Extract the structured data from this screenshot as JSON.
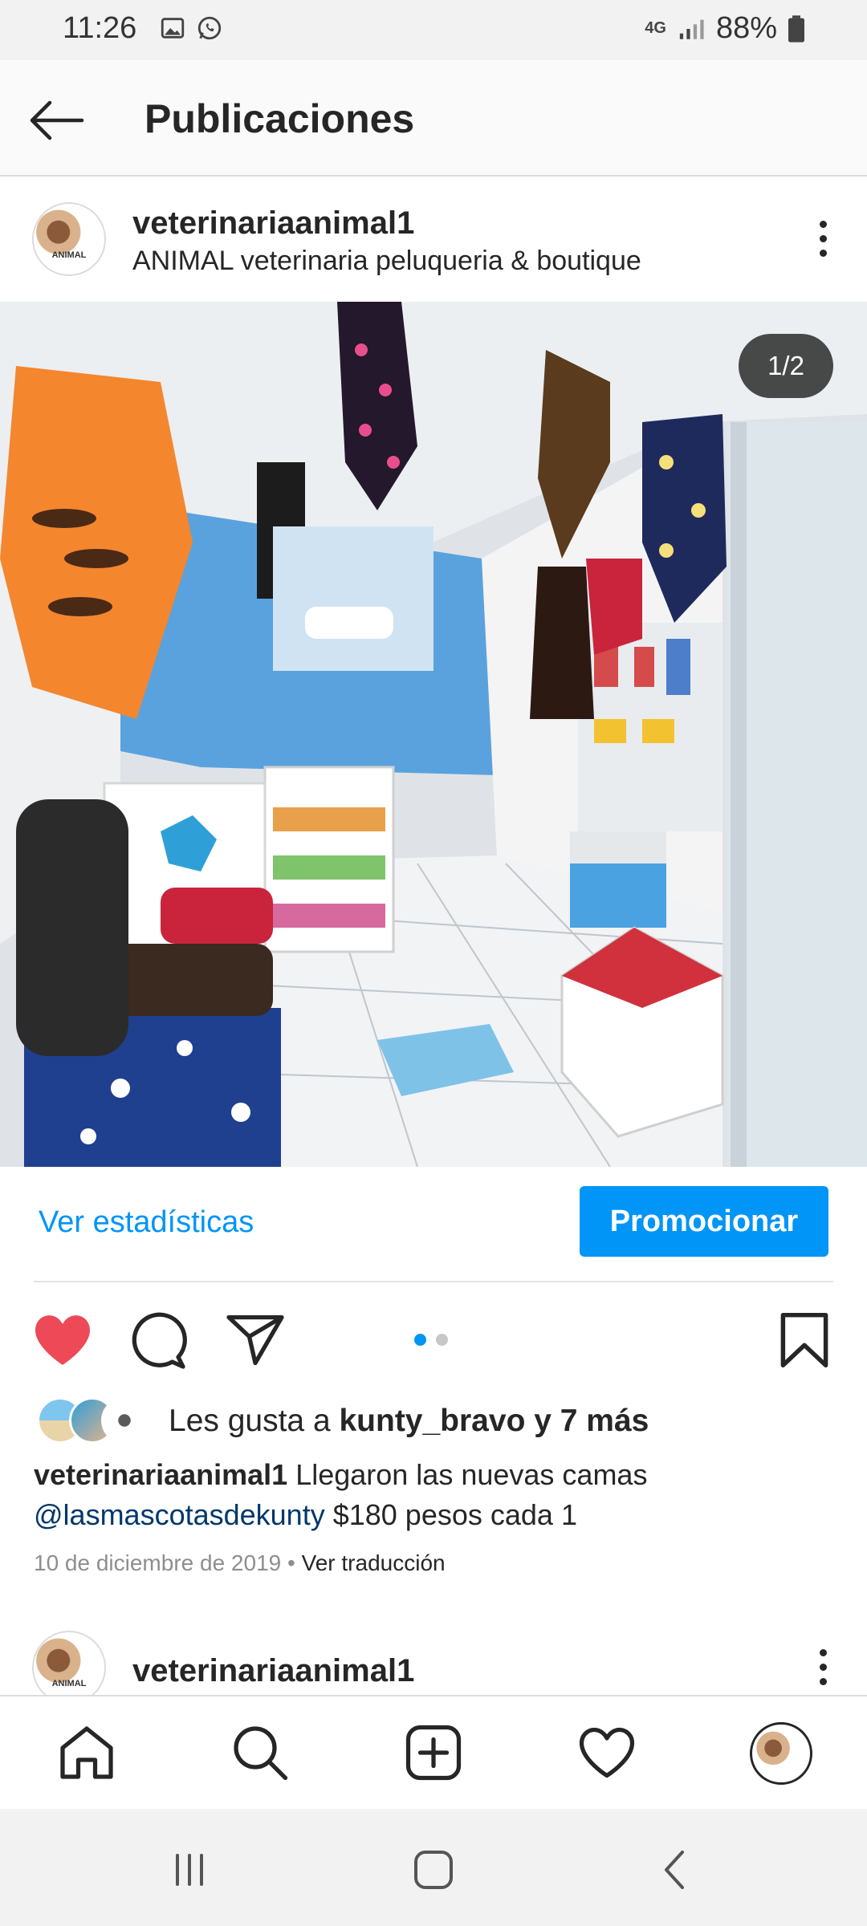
{
  "status_bar": {
    "time": "11:26",
    "network": "4G",
    "battery": "88%"
  },
  "header": {
    "title": "Publicaciones"
  },
  "post": {
    "username": "veterinariaanimal1",
    "subtitle": "ANIMAL veterinaria peluqueria & boutique",
    "avatar_text": "ANIMAL",
    "carousel_position": "1/2",
    "stats_label": "Ver estadísticas",
    "promote_label": "Promocionar",
    "likes": {
      "prefix": "Les gusta a ",
      "user": "kunty_bravo",
      "suffix": " y 7 más"
    },
    "caption": {
      "user": "veterinariaanimal1",
      "text": " Llegaron las  nuevas camas",
      "mention": "@lasmascotasdekunty",
      "text2": " $180 pesos cada 1"
    },
    "date": "10 de diciembre de 2019",
    "separator": " • ",
    "translate_label": "Ver traducción",
    "liked": true
  },
  "next_post": {
    "username": "veterinariaanimal1"
  },
  "icons": {
    "back": "arrow-left-icon",
    "more": "more-vertical-icon",
    "like": "heart-filled-icon",
    "comment": "comment-icon",
    "share": "paper-plane-icon",
    "save": "bookmark-icon"
  },
  "colors": {
    "accent": "#0095f6",
    "like": "#ed4956",
    "mention": "#00376b",
    "muted": "#8e8e8e"
  }
}
